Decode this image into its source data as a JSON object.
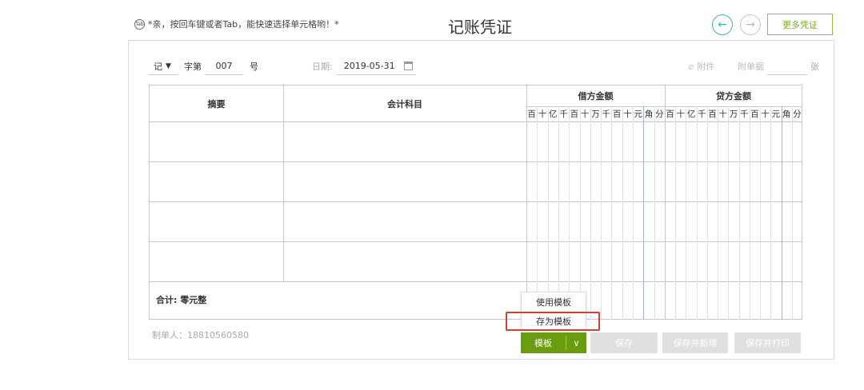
{
  "header": {
    "hint_icon": "keyboard-icon",
    "hint_icon_text": "Tab",
    "hint_text": "*亲，按回车键或者Tab，能快速选择单元格哟！*",
    "title": "记账凭证",
    "prev_icon": "←",
    "next_icon": "→",
    "more_label": "更多凭证"
  },
  "meta": {
    "voucher_type": "记",
    "word_label": "字第",
    "number": "007",
    "number_suffix": "号",
    "date_label": "日期:",
    "date_value": "2019-05-31",
    "attach_icon": "⌀",
    "attach_label": "附件",
    "docs_label": "附单据",
    "docs_value": "",
    "docs_unit": "张"
  },
  "table": {
    "col_summary": "摘要",
    "col_account": "会计科目",
    "col_debit": "借方金额",
    "col_credit": "贷方金额",
    "units": [
      "百",
      "十",
      "亿",
      "千",
      "百",
      "十",
      "万",
      "千",
      "百",
      "十",
      "元",
      "角",
      "分"
    ],
    "total_label": "合计:  零元整"
  },
  "footer": {
    "maker": "制单人：18810560580",
    "template_label": "模板",
    "template_chevron": "∨",
    "save_label": "保存",
    "save_new_label": "保存并新增",
    "save_print_label": "保存并打印"
  },
  "dropdown": {
    "items": [
      "使用模板",
      "存为模板"
    ]
  },
  "colors": {
    "accent_green": "#6a9c0f",
    "teal": "#44b3ad",
    "highlight_red": "#d9402b"
  }
}
